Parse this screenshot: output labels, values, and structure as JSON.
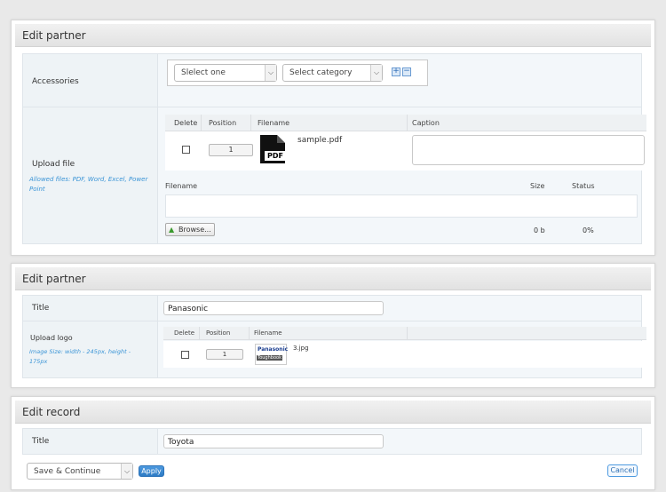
{
  "panel1": {
    "title": "Edit partner",
    "accessories": {
      "label": "Accessories",
      "select_one": "Slelect one",
      "select_category": "Select category"
    },
    "upload": {
      "label": "Upload file",
      "note": "Allowed files: PDF, Word, Excel, Power Point",
      "headers": {
        "delete": "Delete",
        "position": "Position",
        "filename": "Filename",
        "caption": "Caption"
      },
      "row": {
        "position": "1",
        "filename": "sample.pdf",
        "icon_text": "PDF",
        "caption": ""
      },
      "queue_headers": {
        "filename": "Filename",
        "size": "Size",
        "status": "Status"
      },
      "browse_label": "Browse...",
      "size_value": "0 b",
      "status_value": "0%"
    }
  },
  "panel2": {
    "title": "Edit partner",
    "title_label": "Title",
    "title_value": "Panasonic",
    "logo": {
      "label": "Upload logo",
      "note": "Image Size: width - 245px, height - 175px",
      "headers": {
        "delete": "Delete",
        "position": "Position",
        "filename": "Filename"
      },
      "row": {
        "position": "1",
        "filename": "3.jpg",
        "thumb_line1": "Panasonic",
        "thumb_line2": "Toughbook"
      }
    }
  },
  "panel3": {
    "title": "Edit record",
    "title_label": "Title",
    "title_value": "Toyota",
    "action_select": "Save & Continue",
    "apply_label": "Apply",
    "cancel_label": "Cancel"
  },
  "colors": {
    "accent": "#3a94d6",
    "panel_header": "#e6e6e6",
    "row_bg": "#f3f7fa"
  }
}
